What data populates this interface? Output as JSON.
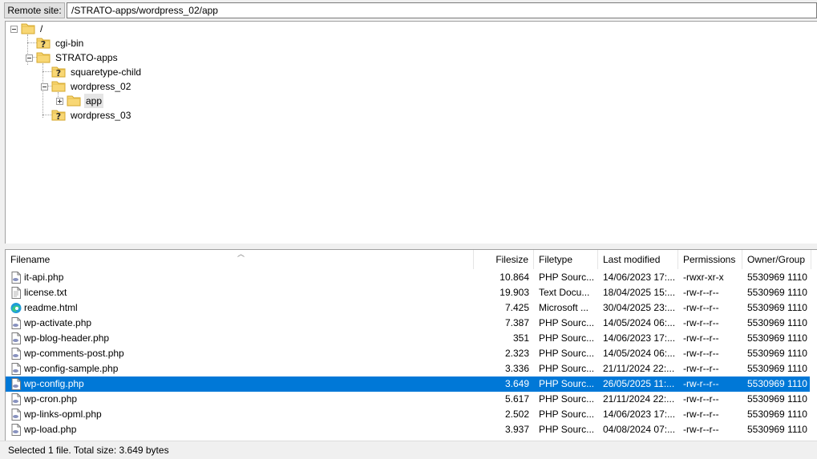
{
  "remote_site": {
    "label": "Remote site:",
    "path": "/STRATO-apps/wordpress_02/app"
  },
  "tree": [
    {
      "label": "/",
      "icon": "folder-icon",
      "depth": 0,
      "expander": "minus"
    },
    {
      "label": "cgi-bin",
      "icon": "folder-unknown-icon",
      "depth": 1,
      "expander": "none"
    },
    {
      "label": "STRATO-apps",
      "icon": "folder-icon",
      "depth": 1,
      "expander": "minus"
    },
    {
      "label": "squaretype-child",
      "icon": "folder-unknown-icon",
      "depth": 2,
      "expander": "none"
    },
    {
      "label": "wordpress_02",
      "icon": "folder-icon",
      "depth": 2,
      "expander": "minus"
    },
    {
      "label": "app",
      "icon": "folder-icon",
      "depth": 3,
      "expander": "plus",
      "selected": true
    },
    {
      "label": "wordpress_03",
      "icon": "folder-unknown-icon",
      "depth": 2,
      "expander": "none"
    }
  ],
  "file_list": {
    "columns": [
      "Filename",
      "Filesize",
      "Filetype",
      "Last modified",
      "Permissions",
      "Owner/Group"
    ],
    "rows": [
      {
        "name": "it-api.php",
        "size": "10.864",
        "type": "PHP Sourc...",
        "modified": "14/06/2023 17:...",
        "perms": "-rwxr-xr-x",
        "owner": "5530969 1110",
        "icon": "php-file-icon"
      },
      {
        "name": "license.txt",
        "size": "19.903",
        "type": "Text Docu...",
        "modified": "18/04/2025 15:...",
        "perms": "-rw-r--r--",
        "owner": "5530969 1110",
        "icon": "text-file-icon"
      },
      {
        "name": "readme.html",
        "size": "7.425",
        "type": "Microsoft ...",
        "modified": "30/04/2025 23:...",
        "perms": "-rw-r--r--",
        "owner": "5530969 1110",
        "icon": "edge-html-icon"
      },
      {
        "name": "wp-activate.php",
        "size": "7.387",
        "type": "PHP Sourc...",
        "modified": "14/05/2024 06:...",
        "perms": "-rw-r--r--",
        "owner": "5530969 1110",
        "icon": "php-file-icon"
      },
      {
        "name": "wp-blog-header.php",
        "size": "351",
        "type": "PHP Sourc...",
        "modified": "14/06/2023 17:...",
        "perms": "-rw-r--r--",
        "owner": "5530969 1110",
        "icon": "php-file-icon"
      },
      {
        "name": "wp-comments-post.php",
        "size": "2.323",
        "type": "PHP Sourc...",
        "modified": "14/05/2024 06:...",
        "perms": "-rw-r--r--",
        "owner": "5530969 1110",
        "icon": "php-file-icon"
      },
      {
        "name": "wp-config-sample.php",
        "size": "3.336",
        "type": "PHP Sourc...",
        "modified": "21/11/2024 22:...",
        "perms": "-rw-r--r--",
        "owner": "5530969 1110",
        "icon": "php-file-icon"
      },
      {
        "name": "wp-config.php",
        "size": "3.649",
        "type": "PHP Sourc...",
        "modified": "26/05/2025 11:...",
        "perms": "-rw-r--r--",
        "owner": "5530969 1110",
        "icon": "php-file-icon",
        "selected": true
      },
      {
        "name": "wp-cron.php",
        "size": "5.617",
        "type": "PHP Sourc...",
        "modified": "21/11/2024 22:...",
        "perms": "-rw-r--r--",
        "owner": "5530969 1110",
        "icon": "php-file-icon"
      },
      {
        "name": "wp-links-opml.php",
        "size": "2.502",
        "type": "PHP Sourc...",
        "modified": "14/06/2023 17:...",
        "perms": "-rw-r--r--",
        "owner": "5530969 1110",
        "icon": "php-file-icon"
      },
      {
        "name": "wp-load.php",
        "size": "3.937",
        "type": "PHP Sourc...",
        "modified": "04/08/2024 07:...",
        "perms": "-rw-r--r--",
        "owner": "5530969 1110",
        "icon": "php-file-icon"
      }
    ]
  },
  "status_bar": {
    "text": "Selected 1 file. Total size: 3.649 bytes"
  },
  "colors": {
    "selection": "#0078d7",
    "folder": "#f8d775",
    "unknown_marker": "#2b2b2b"
  }
}
